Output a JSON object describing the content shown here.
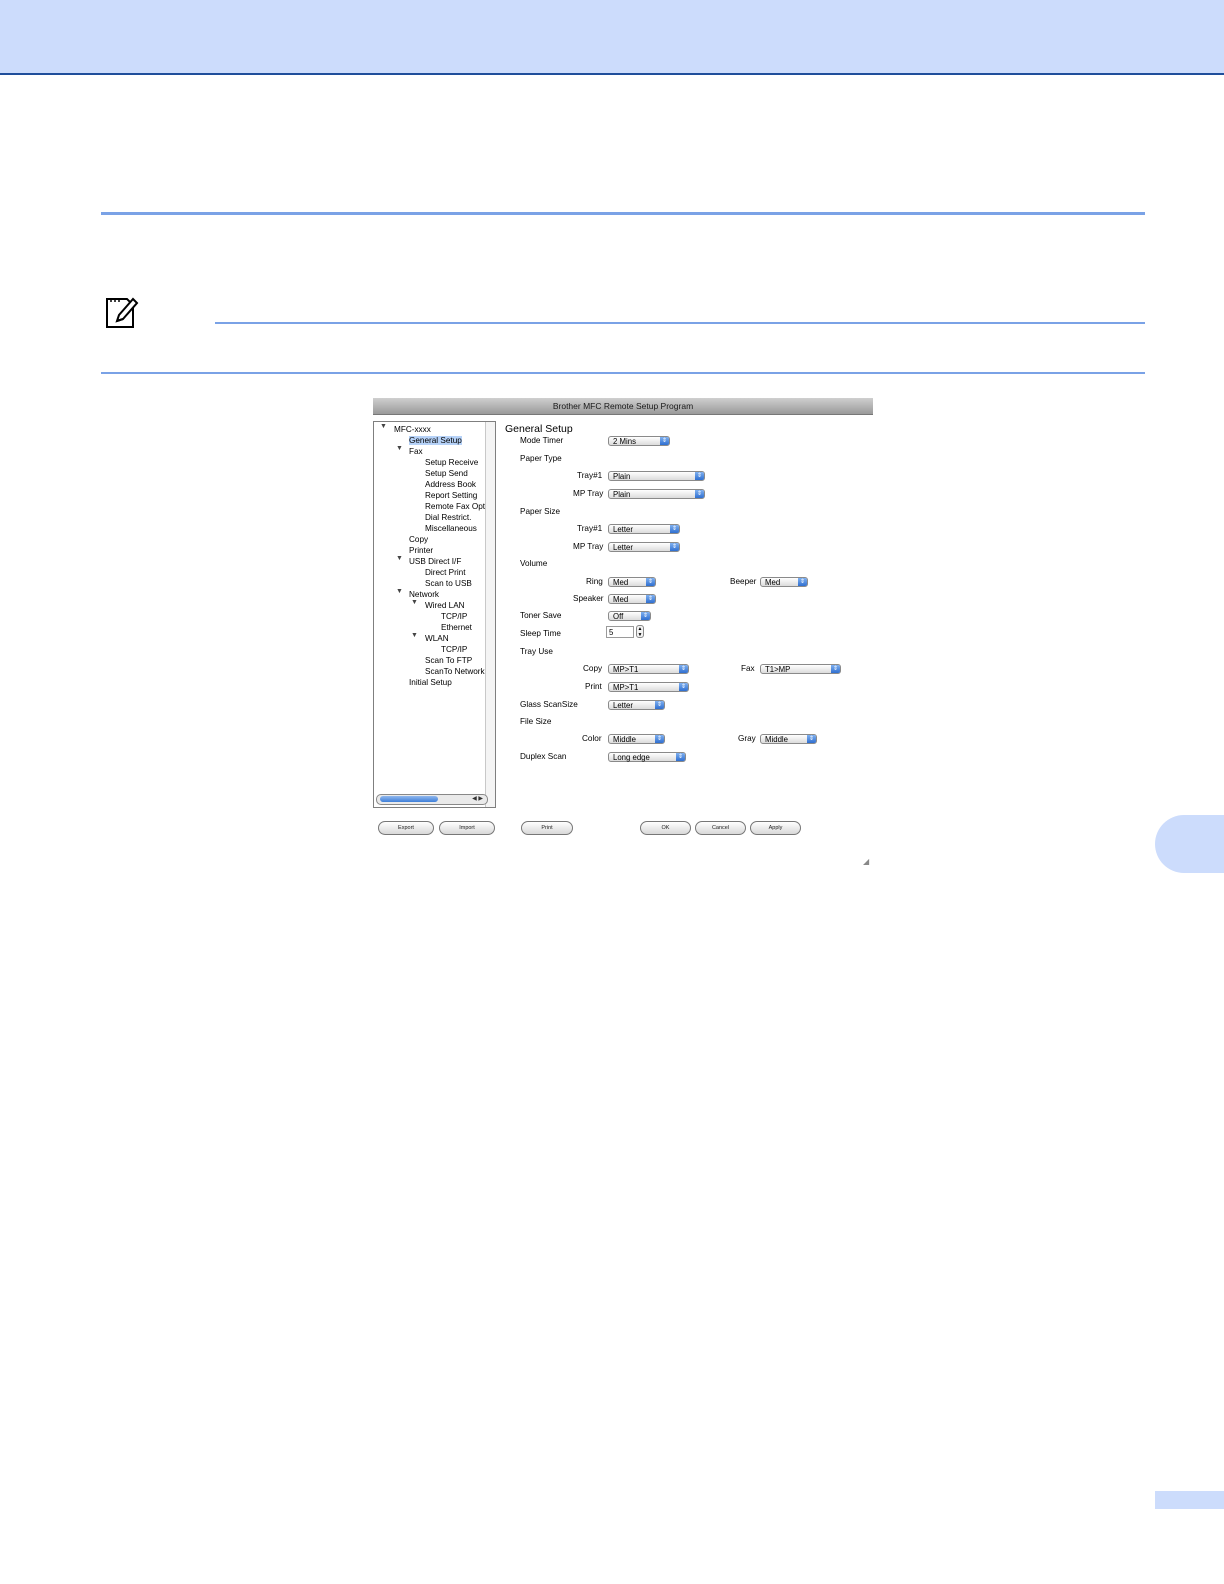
{
  "window": {
    "title": "Brother MFC Remote Setup Program",
    "tree": [
      "MFC-xxxx",
      "General Setup",
      "Fax",
      "Setup Receive",
      "Setup Send",
      "Address Book",
      "Report Setting",
      "Remote Fax Opt",
      "Dial Restrict.",
      "Miscellaneous",
      "Copy",
      "Printer",
      "USB Direct I/F",
      "Direct Print",
      "Scan to USB",
      "Network",
      "Wired LAN",
      "TCP/IP",
      "Ethernet",
      "WLAN",
      "TCP/IP",
      "Scan To FTP",
      "ScanTo Network",
      "Initial Setup"
    ],
    "panel": {
      "heading": "General Setup",
      "mode_timer_label": "Mode Timer",
      "mode_timer_value": "2 Mins",
      "paper_type_label": "Paper Type",
      "tray1_label": "Tray#1",
      "paper_type_tray1": "Plain",
      "mp_tray_label": "MP Tray",
      "paper_type_mp": "Plain",
      "paper_size_label": "Paper Size",
      "paper_size_tray1": "Letter",
      "paper_size_mp": "Letter",
      "volume_label": "Volume",
      "ring_label": "Ring",
      "ring_value": "Med",
      "beeper_label": "Beeper",
      "beeper_value": "Med",
      "speaker_label": "Speaker",
      "speaker_value": "Med",
      "toner_save_label": "Toner Save",
      "toner_save_value": "Off",
      "sleep_time_label": "Sleep Time",
      "sleep_time_value": "5",
      "tray_use_label": "Tray Use",
      "copy_label": "Copy",
      "copy_value": "MP>T1",
      "fax_label": "Fax",
      "fax_value": "T1>MP",
      "print_label": "Print",
      "print_value": "MP>T1",
      "glass_scansize_label": "Glass ScanSize",
      "glass_scansize_value": "Letter",
      "file_size_label": "File Size",
      "color_label": "Color",
      "color_value": "Middle",
      "gray_label": "Gray",
      "gray_value": "Middle",
      "duplex_scan_label": "Duplex Scan",
      "duplex_scan_value": "Long edge"
    },
    "buttons": {
      "export": "Export",
      "import": "Import",
      "print": "Print",
      "ok": "OK",
      "cancel": "Cancel",
      "apply": "Apply"
    }
  }
}
